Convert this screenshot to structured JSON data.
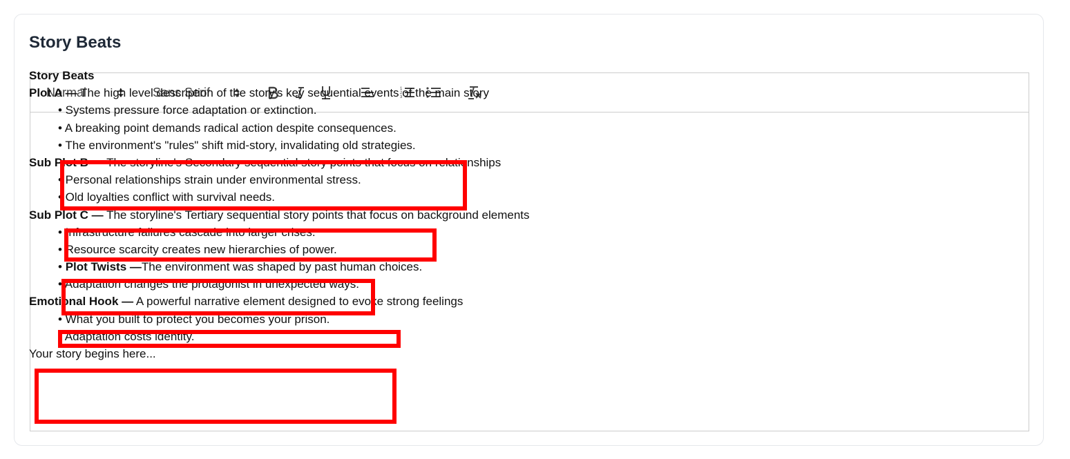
{
  "card": {
    "title": "Story Beats"
  },
  "toolbar": {
    "header_select": "Normal",
    "font_select": "Sans Serif",
    "bold_icon": "bold-icon",
    "italic_icon": "italic-icon",
    "underline_icon": "underline-icon",
    "align_icon": "align-left-icon",
    "ordered_list_icon": "ordered-list-icon",
    "bullet_list_icon": "bullet-list-icon",
    "clean_icon": "clear-format-icon"
  },
  "content": {
    "heading": "Story Beats",
    "plot_a": {
      "label": "Plot A —",
      "text": " The high level description of the story's key sequential events of the main story",
      "items": [
        "• Systems pressure force adaptation or extinction.",
        "• A breaking point demands radical action despite consequences.",
        "• The environment's \"rules\" shift mid-story, invalidating old strategies."
      ]
    },
    "sub_plot_b": {
      "label": "Sub Plot B —",
      "text": " The storyline's Secondary sequential story points that focus on relationships",
      "items": [
        "• Personal relationships strain under environmental stress.",
        "• Old loyalties conflict with survival needs."
      ]
    },
    "sub_plot_c": {
      "label": "Sub Plot C —",
      "text": " The storyline's Tertiary sequential story points that focus on background elements",
      "items": [
        "• Infrastructure failures cascade into larger crises.",
        "• Resource scarcity creates new hierarchies of power."
      ],
      "twists_bullet": "• ",
      "twists_label": "Plot Twists —",
      "twists_text": "The environment was shaped by past human choices.",
      "twists_item": "• Adaptation changes the protagonist in unexpected ways."
    },
    "emotional_hook": {
      "label": "Emotional Hook —",
      "text": " A powerful narrative element designed to evoke strong feelings",
      "items": [
        "• What you built to protect you becomes your prison.",
        "• Adaptation costs identity."
      ]
    },
    "closing": "Your story begins here..."
  },
  "colors": {
    "highlight": "#ff0000",
    "border": "#cccccc",
    "title": "#1f2937"
  }
}
